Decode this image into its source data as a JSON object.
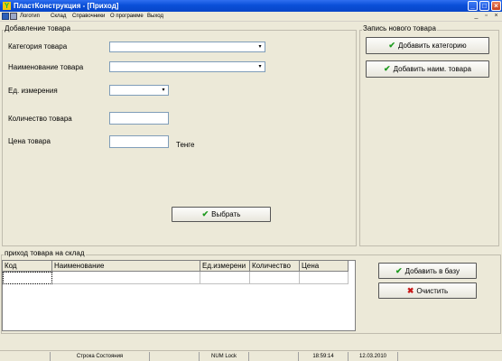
{
  "window": {
    "title": "ПластКонструкция - [Приход]"
  },
  "menu": {
    "items": [
      "Логотип",
      "Склад",
      "Справочники",
      "О программе",
      "Выход"
    ]
  },
  "add_group": {
    "title": "Добавление товара",
    "category_label": "Категория товара",
    "name_label": "Наименование товара",
    "unit_label": "Ед. измерения",
    "qty_label": "Количество товара",
    "price_label": "Цена товара",
    "currency": "Тенге",
    "select_button": "Выбрать"
  },
  "new_item_group": {
    "title": "Запись нового товара",
    "add_category_button": "Добавить категорию",
    "add_name_button": "Добавить наим. товара"
  },
  "arrival_group": {
    "title": "приход товара на склад",
    "columns": [
      "Код",
      "Наименование",
      "Ед.измерени",
      "Количество",
      "Цена"
    ],
    "add_to_db_button": "Добавить в базу",
    "clear_button": "Очистить"
  },
  "statusbar": {
    "status_text": "Строка Состояния",
    "numlock": "NUM Lock",
    "time": "18:59:14",
    "date": "12.03.2010"
  },
  "colors": {
    "titlebar": "#0a4fd8",
    "face": "#ece9d8",
    "check": "#1e9a1e",
    "cross": "#c81818"
  }
}
